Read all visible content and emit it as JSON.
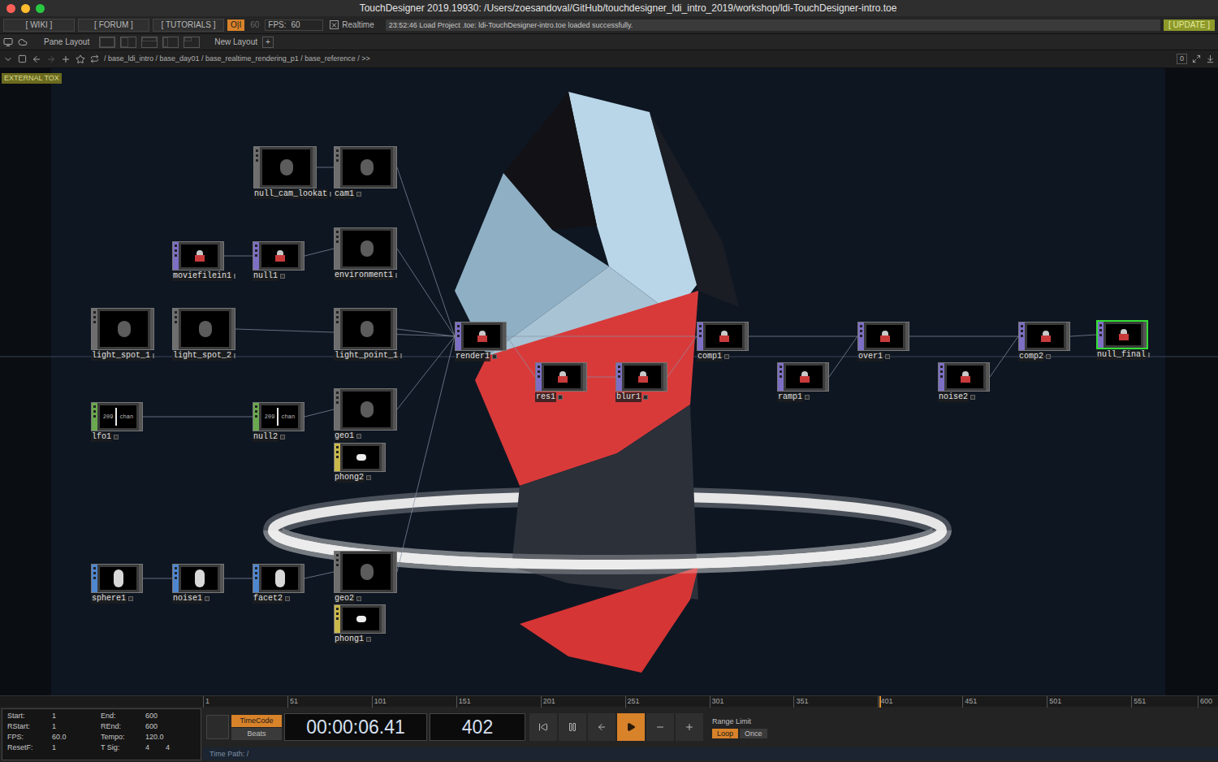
{
  "window": {
    "title": "TouchDesigner 2019.19930: /Users/zoesandoval/GitHub/touchdesigner_ldi_intro_2019/workshop/ldi-TouchDesigner-intro.toe"
  },
  "toolbar": {
    "links": [
      "[ WIKI ]",
      "[ FORUM ]",
      "[ TUTORIALS ]"
    ],
    "oi": "O|I",
    "fps_cap": "60",
    "fps_label": "FPS:",
    "fps_value": "60",
    "realtime": {
      "label": "Realtime",
      "checked": true
    },
    "message": "23:52:46 Load Project .toe: ldi-TouchDesigner-intro.toe loaded successfully.",
    "update": "[ UPDATE ]"
  },
  "layout_bar": {
    "pane_layout": "Pane Layout",
    "new_layout": "New Layout",
    "add": "+"
  },
  "path_bar": {
    "path": "/ base_ldi_intro / base_day01 / base_realtime_rendering_p1 / base_reference / >>",
    "counter": "0"
  },
  "badge": "EXTERNAL TOX",
  "nodes": [
    {
      "name": "null_cam_lookat",
      "kind": "comp",
      "color": "#6e6e6e",
      "selected": false
    },
    {
      "name": "cam1",
      "kind": "comp",
      "color": "#6e6e6e",
      "selected": false
    },
    {
      "name": "moviefilein1",
      "kind": "top",
      "color": "#7d6fc4",
      "selected": false
    },
    {
      "name": "null1",
      "kind": "top",
      "color": "#7d6fc4",
      "selected": false
    },
    {
      "name": "environment1",
      "kind": "comp",
      "color": "#6e6e6e",
      "selected": false
    },
    {
      "name": "light_spot_1",
      "kind": "comp",
      "color": "#6e6e6e",
      "selected": false
    },
    {
      "name": "light_spot_2",
      "kind": "comp",
      "color": "#6e6e6e",
      "selected": false
    },
    {
      "name": "light_point_1",
      "kind": "comp",
      "color": "#6e6e6e",
      "selected": false
    },
    {
      "name": "render1",
      "kind": "top",
      "color": "#7d6fc4",
      "selected": false
    },
    {
      "name": "res1",
      "kind": "top",
      "color": "#7d6fc4",
      "selected": false
    },
    {
      "name": "blur1",
      "kind": "top",
      "color": "#7d6fc4",
      "selected": false
    },
    {
      "name": "comp1",
      "kind": "top",
      "color": "#7d6fc4",
      "selected": false
    },
    {
      "name": "ramp1",
      "kind": "top",
      "color": "#7d6fc4",
      "selected": false
    },
    {
      "name": "over1",
      "kind": "top",
      "color": "#7d6fc4",
      "selected": false
    },
    {
      "name": "noise2",
      "kind": "top",
      "color": "#7d6fc4",
      "selected": false
    },
    {
      "name": "comp2",
      "kind": "top",
      "color": "#7d6fc4",
      "selected": false
    },
    {
      "name": "null_final",
      "kind": "top",
      "color": "#7d6fc4",
      "selected": true
    },
    {
      "name": "lfo1",
      "kind": "chop",
      "color": "#6aa84f",
      "selected": false,
      "viewer": [
        "209",
        "chan"
      ]
    },
    {
      "name": "null2",
      "kind": "chop",
      "color": "#6aa84f",
      "selected": false,
      "viewer": [
        "209",
        "chan"
      ]
    },
    {
      "name": "geo1",
      "kind": "comp",
      "color": "#6e6e6e",
      "selected": false
    },
    {
      "name": "phong2",
      "kind": "mat",
      "color": "#c9b84a",
      "selected": false
    },
    {
      "name": "sphere1",
      "kind": "sop",
      "color": "#4f86d0",
      "selected": false
    },
    {
      "name": "noise1",
      "kind": "sop",
      "color": "#4f86d0",
      "selected": false
    },
    {
      "name": "facet2",
      "kind": "sop",
      "color": "#4f86d0",
      "selected": false
    },
    {
      "name": "geo2",
      "kind": "comp",
      "color": "#6e6e6e",
      "selected": false
    },
    {
      "name": "phong1",
      "kind": "mat",
      "color": "#c9b84a",
      "selected": false
    }
  ],
  "wires": [
    {
      "from": "null_cam_lookat",
      "to": "cam1"
    },
    {
      "from": "cam1",
      "to": "render1"
    },
    {
      "from": "moviefilein1",
      "to": "null1"
    },
    {
      "from": "null1",
      "to": "environment1"
    },
    {
      "from": "environment1",
      "to": "render1"
    },
    {
      "from": "light_spot_2",
      "to": "render1"
    },
    {
      "from": "light_point_1",
      "to": "render1"
    },
    {
      "from": "lfo1",
      "to": "null2"
    },
    {
      "from": "null2",
      "to": "geo1"
    },
    {
      "from": "geo1",
      "to": "render1"
    },
    {
      "from": "geo2",
      "to": "render1"
    },
    {
      "from": "sphere1",
      "to": "noise1"
    },
    {
      "from": "noise1",
      "to": "facet2"
    },
    {
      "from": "facet2",
      "to": "geo2"
    },
    {
      "from": "render1",
      "to": "res1"
    },
    {
      "from": "res1",
      "to": "blur1"
    },
    {
      "from": "blur1",
      "to": "comp1"
    },
    {
      "from": "render1",
      "to": "comp1"
    },
    {
      "from": "comp1",
      "to": "over1"
    },
    {
      "from": "ramp1",
      "to": "over1"
    },
    {
      "from": "over1",
      "to": "comp2"
    },
    {
      "from": "noise2",
      "to": "comp2"
    },
    {
      "from": "comp2",
      "to": "null_final"
    }
  ],
  "timeline": {
    "ticks": [
      "1",
      "51",
      "101",
      "151",
      "201",
      "251",
      "301",
      "351",
      "401",
      "451",
      "501",
      "551",
      "600"
    ],
    "level": 0.669
  },
  "time_settings": [
    {
      "label": "Start:",
      "values": [
        "1"
      ]
    },
    {
      "label": "End:",
      "values": [
        "600"
      ]
    },
    {
      "label": "RStart:",
      "values": [
        "1"
      ]
    },
    {
      "label": "REnd:",
      "values": [
        "600"
      ]
    },
    {
      "label": "FPS:",
      "values": [
        "60.0"
      ]
    },
    {
      "label": "Tempo:",
      "values": [
        "120.0"
      ]
    },
    {
      "label": "ResetF:",
      "values": [
        "1"
      ]
    },
    {
      "label": "T Sig:",
      "values": [
        "4",
        "4"
      ]
    }
  ],
  "timecode_modes": [
    {
      "label": "TimeCode",
      "selected": true
    },
    {
      "label": "Beats",
      "selected": false
    }
  ],
  "timecode": "00:00:06.41",
  "frame": "402",
  "transport": [
    {
      "selected": false
    },
    {
      "selected": false
    },
    {
      "selected": false
    },
    {
      "selected": true
    },
    {
      "selected": false
    },
    {
      "selected": false
    }
  ],
  "range_limit": {
    "label": "Range Limit",
    "options": [
      {
        "label": "Loop",
        "selected": true
      },
      {
        "label": "Once",
        "selected": false
      }
    ]
  },
  "time_path": "Time Path: /"
}
